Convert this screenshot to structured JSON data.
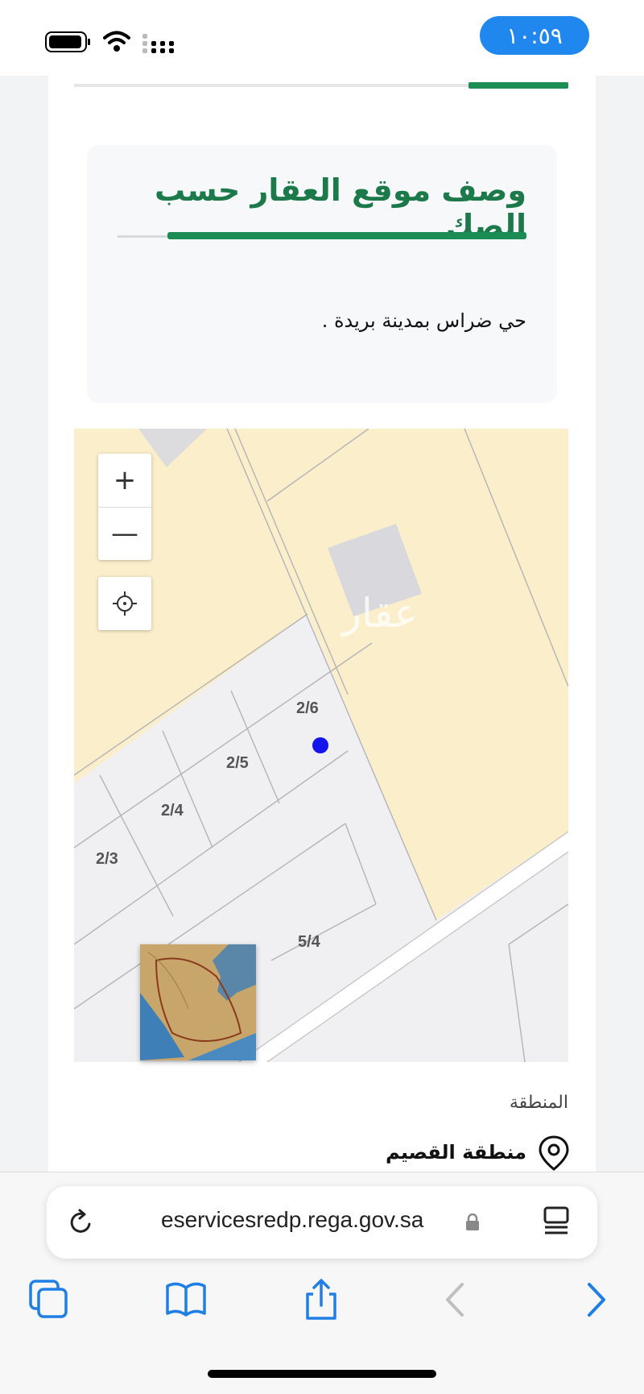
{
  "status_bar": {
    "time": "١٠:٥٩"
  },
  "property": {
    "title": "وصف موقع العقار حسب الصك",
    "description": "حي ضراس بمدينة بريدة ."
  },
  "map": {
    "zoom_in_label": "+",
    "zoom_out_label": "—",
    "watermark": "عقار",
    "parcels": [
      "2/6",
      "2/5",
      "2/4",
      "2/3",
      "5/4"
    ]
  },
  "region": {
    "label": "المنطقة",
    "value": "منطقة القصيم"
  },
  "browser": {
    "url": "eservicesredp.rega.gov.sa"
  },
  "colors": {
    "accent_green": "#1c8c55",
    "time_pill": "#1f87ee",
    "ios_blue": "#1f7fe5",
    "map_sand": "#fbeecb"
  }
}
